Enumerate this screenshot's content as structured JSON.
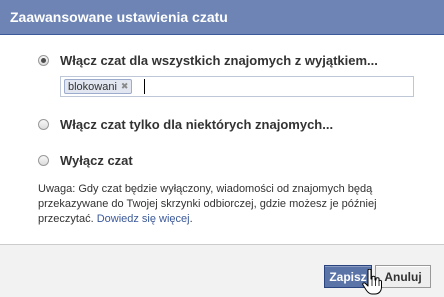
{
  "dialog": {
    "title": "Zaawansowane ustawienia czatu"
  },
  "options": [
    {
      "label": "Włącz czat dla wszystkich znajomych z wyjątkiem...",
      "selected": true
    },
    {
      "label": "Włącz czat tylko dla niektórych znajomych...",
      "selected": false
    },
    {
      "label": "Wyłącz czat",
      "selected": false
    }
  ],
  "exceptions": {
    "tokens": [
      "blokowani"
    ],
    "remove_glyph": "✖",
    "input_value": ""
  },
  "note": {
    "text": "Uwaga: Gdy czat będzie wyłączony, wiadomości od znajomych będą przekazywane do Twojej skrzynki odbiorczej, gdzie możesz je później przeczytać. ",
    "link": "Dowiedz się więcej",
    "trailing": "."
  },
  "buttons": {
    "save": "Zapisz",
    "cancel": "Anuluj"
  },
  "colors": {
    "titlebar": "#6d84b4",
    "link": "#3b5998",
    "save_button": "#5b74a8"
  },
  "icons": {
    "cursor": "hand-pointer-icon"
  }
}
